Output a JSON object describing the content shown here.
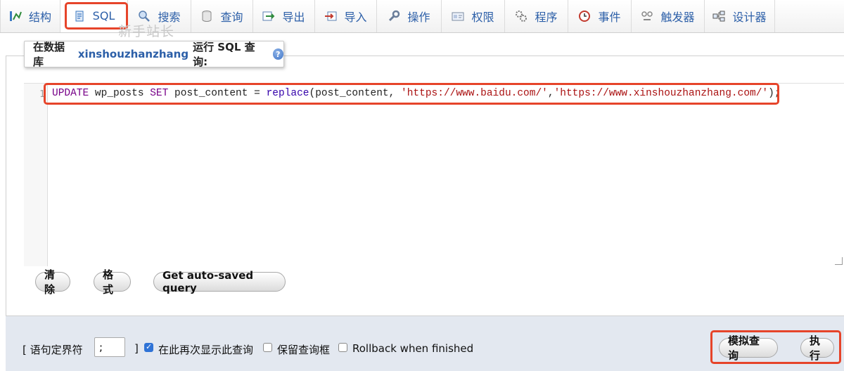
{
  "tabs": [
    {
      "label": "结构",
      "icon": "structure-icon"
    },
    {
      "label": "SQL",
      "icon": "sql-icon"
    },
    {
      "label": "搜索",
      "icon": "search-icon"
    },
    {
      "label": "查询",
      "icon": "query-icon"
    },
    {
      "label": "导出",
      "icon": "export-icon"
    },
    {
      "label": "导入",
      "icon": "import-icon"
    },
    {
      "label": "操作",
      "icon": "wrench-icon"
    },
    {
      "label": "权限",
      "icon": "privileges-icon"
    },
    {
      "label": "程序",
      "icon": "routines-icon"
    },
    {
      "label": "事件",
      "icon": "clock-icon"
    },
    {
      "label": "触发器",
      "icon": "triggers-icon"
    },
    {
      "label": "设计器",
      "icon": "designer-icon"
    }
  ],
  "watermark": "新手站长",
  "legend": {
    "prefix": "在数据库",
    "database": "xinshouzhanzhang",
    "suffix": "运行 SQL 查询:",
    "help": "?"
  },
  "editor": {
    "line_number": "1",
    "tokens": [
      {
        "t": "UPDATE",
        "c": "kw"
      },
      {
        "t": " wp_posts ",
        "c": "plain"
      },
      {
        "t": "SET",
        "c": "kw"
      },
      {
        "t": " post_content = ",
        "c": "plain"
      },
      {
        "t": "replace",
        "c": "fn"
      },
      {
        "t": "(post_content, ",
        "c": "plain"
      },
      {
        "t": "'https://www.baidu.com/'",
        "c": "str"
      },
      {
        "t": ",",
        "c": "plain"
      },
      {
        "t": "'https://www.xinshouzhanzhang.com/'",
        "c": "str"
      },
      {
        "t": ");",
        "c": "plain"
      }
    ]
  },
  "buttons": {
    "clear": "清除",
    "format": "格式",
    "auto_saved": "Get auto-saved query",
    "simulate": "模拟查询",
    "execute": "执行"
  },
  "footer": {
    "delimiter_open": "[ 语句定界符",
    "delimiter_value": ";",
    "delimiter_close": "]",
    "show_again": "在此再次显示此查询",
    "show_again_checked": true,
    "keep_box": "保留查询框",
    "keep_box_checked": false,
    "rollback": "Rollback when finished",
    "rollback_checked": false
  },
  "colors": {
    "highlight": "#e6442a",
    "link": "#2c5fa8",
    "keyword": "#770088",
    "function": "#3300aa",
    "string": "#aa1111"
  }
}
